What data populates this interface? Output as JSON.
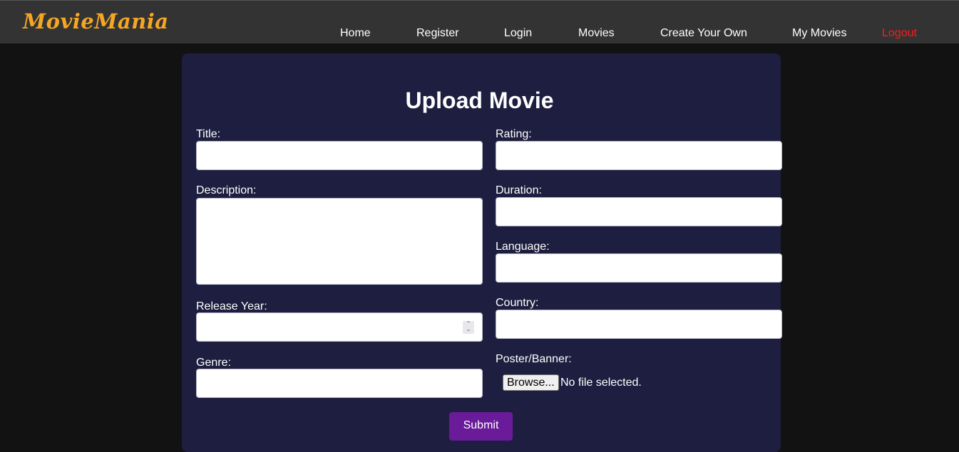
{
  "brand": {
    "logo_text": "MovieMania",
    "logo_color": "#f5a623"
  },
  "nav": {
    "items": [
      {
        "label": "Home"
      },
      {
        "label": "Register"
      },
      {
        "label": "Login"
      },
      {
        "label": "Movies"
      },
      {
        "label": "Create Your Own"
      },
      {
        "label": "My Movies"
      },
      {
        "label": "Logout",
        "color": "#ff1a1a"
      }
    ]
  },
  "form": {
    "title": "Upload Movie",
    "fields": {
      "title": {
        "label": "Title:",
        "value": ""
      },
      "description": {
        "label": "Description:",
        "value": ""
      },
      "release_year": {
        "label": "Release Year:",
        "value": ""
      },
      "genre": {
        "label": "Genre:",
        "value": ""
      },
      "rating": {
        "label": "Rating:",
        "value": ""
      },
      "duration": {
        "label": "Duration:",
        "value": ""
      },
      "language": {
        "label": "Language:",
        "value": ""
      },
      "country": {
        "label": "Country:",
        "value": ""
      },
      "poster": {
        "label": "Poster/Banner:",
        "browse_label": "Browse...",
        "status": "No file selected."
      }
    },
    "submit_label": "Submit",
    "submit_color": "#6a1b9a",
    "card_color": "#1e1f40"
  }
}
